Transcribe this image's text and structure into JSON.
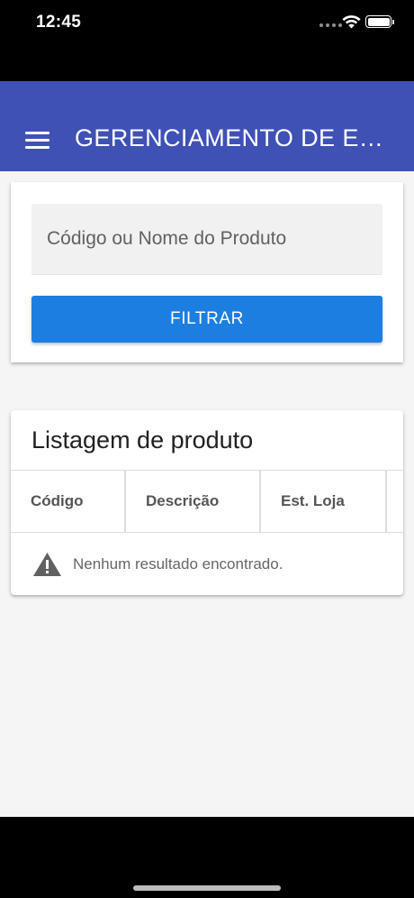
{
  "status_bar": {
    "time": "12:45"
  },
  "app_bar": {
    "title": "GERENCIAMENTO DE ESTOQUE"
  },
  "filter": {
    "search_placeholder": "Código ou Nome do Produto",
    "search_value": "",
    "button_label": "FILTRAR"
  },
  "listing": {
    "title": "Listagem de produto",
    "columns": [
      "Código",
      "Descrição",
      "Est. Loja",
      ""
    ],
    "empty_message": "Nenhum resultado encontrado."
  },
  "colors": {
    "app_bar": "#3f51b5",
    "primary_button": "#1d7ee2",
    "background": "#f5f5f5"
  }
}
